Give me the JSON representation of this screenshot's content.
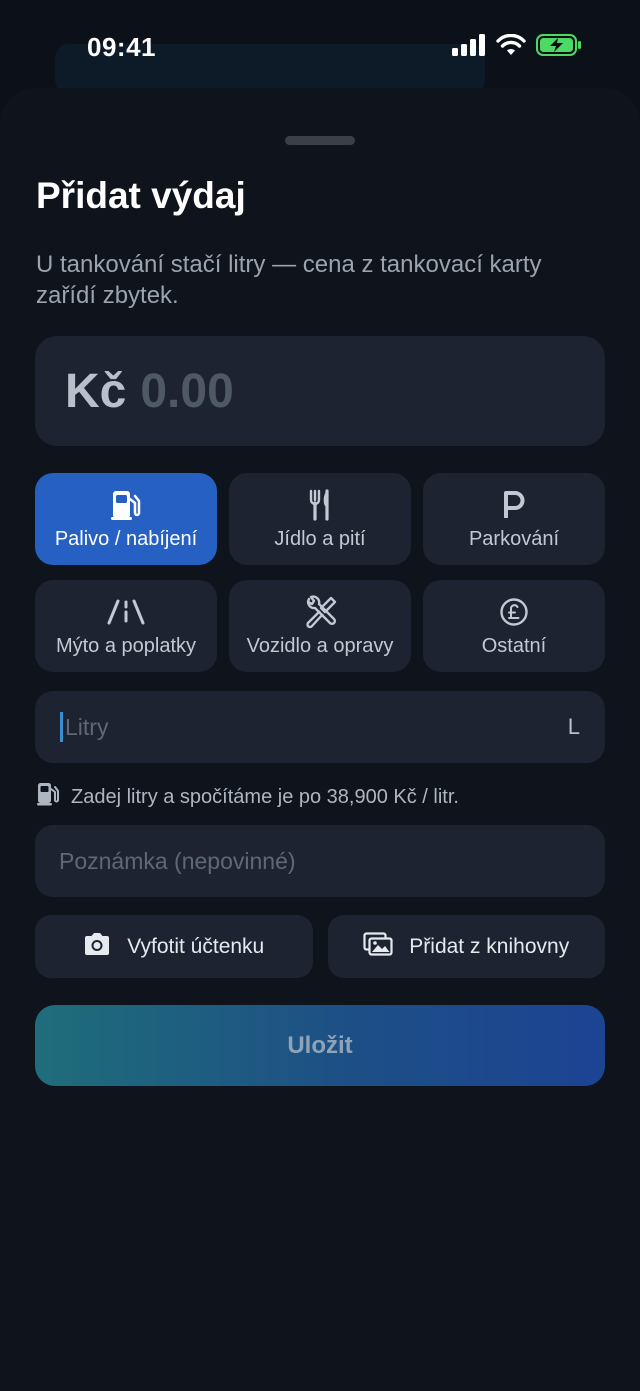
{
  "status_bar": {
    "time": "09:41"
  },
  "sheet": {
    "title": "Přidat výdaj",
    "subtitle": "U tankování stačí litry — cena z tankovací karty zařídí zbytek."
  },
  "amount": {
    "currency": "Kč",
    "value": "0.00"
  },
  "categories": [
    {
      "label": "Palivo / nabíjení",
      "icon": "fuel-pump-icon",
      "selected": true
    },
    {
      "label": "Jídlo a pití",
      "icon": "fork-knife-icon",
      "selected": false
    },
    {
      "label": "Parkování",
      "icon": "parking-icon",
      "selected": false
    },
    {
      "label": "Mýto a poplatky",
      "icon": "road-icon",
      "selected": false
    },
    {
      "label": "Vozidlo a opravy",
      "icon": "wrench-screwdriver-icon",
      "selected": false
    },
    {
      "label": "Ostatní",
      "icon": "pound-coin-icon",
      "selected": false
    }
  ],
  "liters": {
    "placeholder": "Litry",
    "unit": "L"
  },
  "hint": {
    "text": "Zadej litry a spočítáme je po 38,900 Kč / litr."
  },
  "note": {
    "placeholder": "Poznámka (nepovinné)"
  },
  "photo": {
    "camera_label": "Vyfotit účtenku",
    "library_label": "Přidat z knihovny"
  },
  "save": {
    "label": "Uložit"
  },
  "colors": {
    "accent": "#2660c2",
    "card": "#1d2331",
    "sheet": "#0f131b",
    "battery": "#4cd964"
  }
}
